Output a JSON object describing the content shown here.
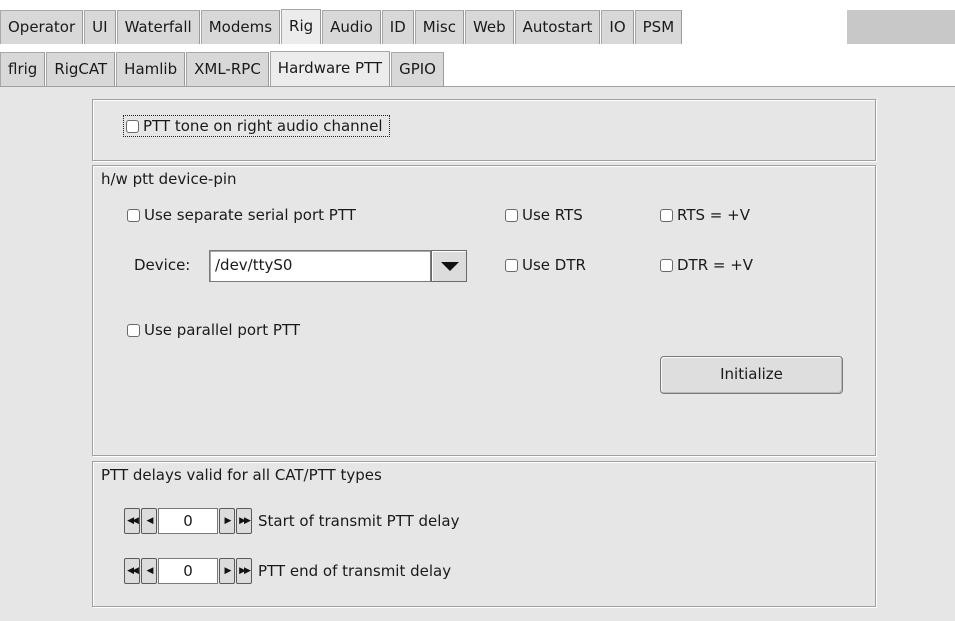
{
  "main_tabs": [
    "Operator",
    "UI",
    "Waterfall",
    "Modems",
    "Rig",
    "Audio",
    "ID",
    "Misc",
    "Web",
    "Autostart",
    "IO",
    "PSM"
  ],
  "main_active": "Rig",
  "sub_tabs": [
    "flrig",
    "RigCAT",
    "Hamlib",
    "XML-RPC",
    "Hardware PTT",
    "GPIO"
  ],
  "sub_active": "Hardware PTT",
  "tone_group": {
    "ptt_tone_label": "PTT tone on right audio channel",
    "ptt_tone_checked": false
  },
  "hw_group": {
    "title": "h/w ptt device-pin",
    "separate_serial_label": "Use separate serial port PTT",
    "use_rts_label": "Use RTS",
    "rts_v_label": "RTS = +V",
    "device_label": "Device:",
    "device_value": "/dev/ttyS0",
    "use_dtr_label": "Use DTR",
    "dtr_v_label": "DTR = +V",
    "parallel_label": "Use parallel port PTT",
    "initialize_label": "Initialize"
  },
  "delay_group": {
    "title": "PTT delays valid for all CAT/PTT types",
    "start_value": "0",
    "start_label": "Start of transmit PTT delay",
    "end_value": "0",
    "end_label": "PTT end of transmit delay"
  },
  "icons": {
    "fast_back": "double-left-arrow",
    "back": "left-arrow",
    "forward": "right-arrow",
    "fast_forward": "double-right-arrow",
    "dropdown": "triangle-down"
  },
  "colors": {
    "panel_bg": "#e6e6e6",
    "tab_bg": "#d8d8d8",
    "active_tab_bg": "#ececec"
  }
}
